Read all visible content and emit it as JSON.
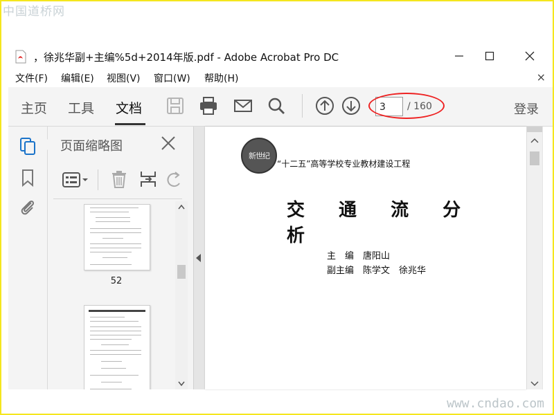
{
  "watermark": {
    "top": "中国道桥网",
    "bottom": "www.cndao.com"
  },
  "window": {
    "title": "，徐兆华副+主编%5d+2014年版.pdf - Adobe Acrobat Pro DC"
  },
  "menu": {
    "items": [
      "文件(F)",
      "编辑(E)",
      "视图(V)",
      "窗口(W)",
      "帮助(H)"
    ],
    "close": "×"
  },
  "toolbar": {
    "tabs": [
      "主页",
      "工具",
      "文档"
    ],
    "active_tab": "文档",
    "current_page": "3",
    "total_pages": "/ 160",
    "login": "登录"
  },
  "panel": {
    "title": "页面缩略图",
    "thumbnails": [
      {
        "label": "52"
      }
    ]
  },
  "document": {
    "seal_text": "新世纪",
    "series": "“十二五”高等学校专业教材建设工程",
    "title": "交 通 流 分 析",
    "chief_editor_label": "主　编",
    "chief_editor": "唐阳山",
    "deputy_editor_label": "副主编",
    "deputy_editors": "陈学文　徐兆华"
  },
  "colors": {
    "highlight_ellipse": "#e22222",
    "frame": "#f5e61e"
  }
}
